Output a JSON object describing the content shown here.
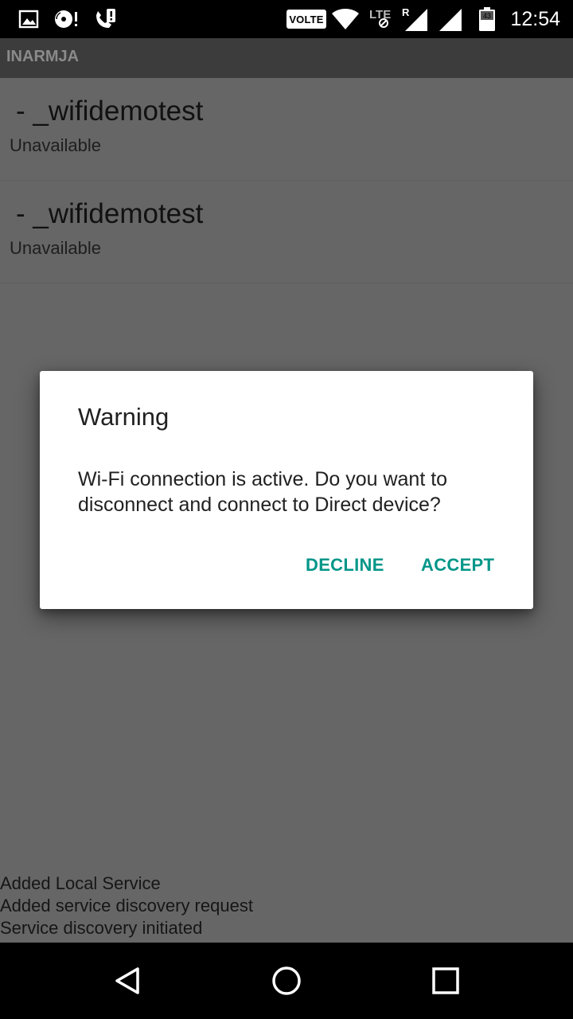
{
  "status_bar": {
    "volte_label": "VOLTE",
    "lte_label": "LTE",
    "roaming_label": "R",
    "battery_level": "43",
    "time": "12:54",
    "icons": [
      "image-notification-icon",
      "disc-sync-icon",
      "missed-call-icon",
      "wifi-icon",
      "lte-icon",
      "signal-roaming-icon",
      "signal-icon",
      "battery-icon"
    ]
  },
  "app_bar": {
    "title": "INARMJA"
  },
  "devices": [
    {
      "name": " - _wifidemotest",
      "status": "Unavailable"
    },
    {
      "name": " - _wifidemotest",
      "status": "Unavailable"
    }
  ],
  "log": [
    "Added Local Service",
    "Added service discovery request",
    "Service discovery initiated"
  ],
  "dialog": {
    "title": "Warning",
    "message": "Wi-Fi connection is active. Do you want to disconnect and connect to Direct device?",
    "decline_label": "DECLINE",
    "accept_label": "ACCEPT",
    "accent_color": "#009688"
  },
  "nav_bar": {
    "icons": [
      "back-icon",
      "home-icon",
      "recents-icon"
    ]
  },
  "colors": {
    "scrim_background": "#666666",
    "status_bar": "#000000",
    "dialog_background": "#ffffff"
  }
}
